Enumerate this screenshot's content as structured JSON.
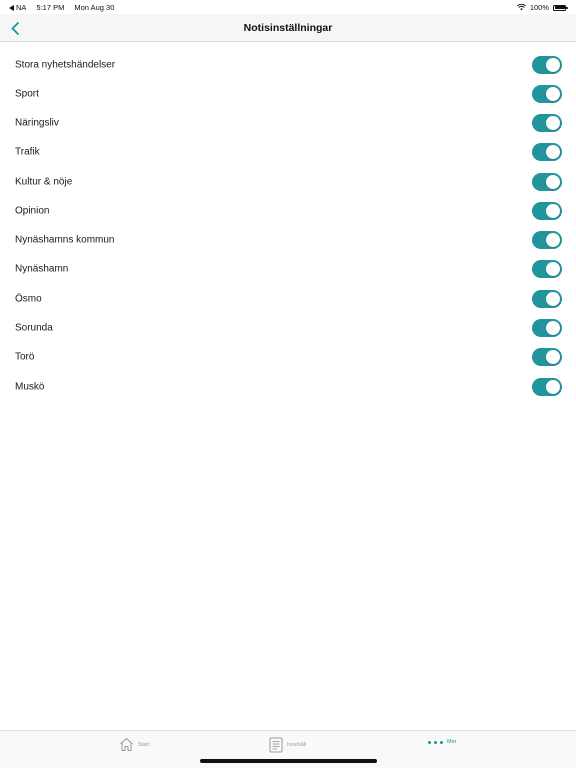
{
  "status_bar": {
    "back_app": "NA",
    "time": "5:17 PM",
    "date": "Mon Aug 30",
    "battery": "100%"
  },
  "nav": {
    "title": "Notisinställningar"
  },
  "settings": [
    {
      "label": "Stora nyhetshändelser",
      "enabled": true
    },
    {
      "label": "Sport",
      "enabled": true
    },
    {
      "label": "Näringsliv",
      "enabled": true
    },
    {
      "label": "Trafik",
      "enabled": true
    },
    {
      "label": "Kultur & nöje",
      "enabled": true
    },
    {
      "label": "Opinion",
      "enabled": true
    },
    {
      "label": "Nynäshamns kommun",
      "enabled": true
    },
    {
      "label": "Nynäshamn",
      "enabled": true
    },
    {
      "label": "Ösmo",
      "enabled": true
    },
    {
      "label": "Sorunda",
      "enabled": true
    },
    {
      "label": "Torö",
      "enabled": true
    },
    {
      "label": "Muskö",
      "enabled": true
    }
  ],
  "tabs": {
    "start": "Start",
    "innehall": "Innehåll",
    "mer": "Mer"
  },
  "colors": {
    "accent": "#21959b"
  }
}
